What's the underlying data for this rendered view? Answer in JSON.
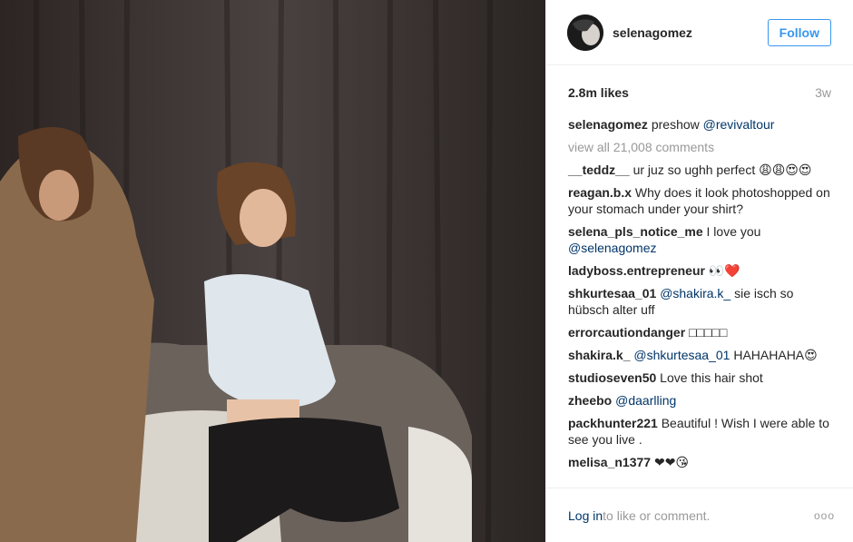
{
  "post": {
    "username": "selenagomez",
    "follow_label": "Follow",
    "likes": "2.8m likes",
    "time": "3w",
    "caption_user": "selenagomez",
    "caption_text": "preshow",
    "caption_mention": "@revivaltour",
    "view_all": "view all 21,008 comments"
  },
  "comments": [
    {
      "user": "__teddz__",
      "text": " ur juz so ughh perfect 😩😩😍😍"
    },
    {
      "user": "reagan.b.x",
      "text": " Why does it look photoshopped on your stomach under your shirt?"
    },
    {
      "user": "selena_pls_notice_me",
      "text": " I love you",
      "mention": "@selenagomez"
    },
    {
      "user": "ladyboss.entrepreneur",
      "text": " 👀❤️"
    },
    {
      "user": "shkurtesaa_01",
      "mention": "@shakira.k_",
      "text": " sie isch so hübsch alter uff"
    },
    {
      "user": "errorcautiondanger",
      "text": " □□□□□"
    },
    {
      "user": "shakira.k_",
      "mention": "@shkurtesaa_01",
      "text": " HAHAHAHA😍"
    },
    {
      "user": "studioseven50",
      "text": " Love this hair shot"
    },
    {
      "user": "zheebo",
      "mention": "@daarlling",
      "text": ""
    },
    {
      "user": "packhunter221",
      "text": " Beautiful ! Wish I were able to see you live ."
    },
    {
      "user": "melisa_n1377",
      "text": " ❤❤😘"
    }
  ],
  "footer": {
    "login_link": "Log in",
    "prompt": " to like or comment.",
    "more": "ooo"
  }
}
